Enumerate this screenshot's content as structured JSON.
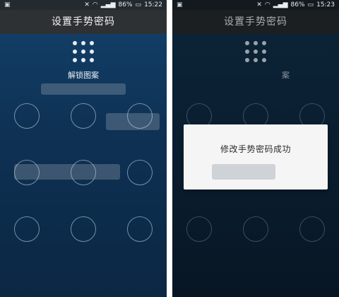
{
  "left_screen": {
    "status": {
      "left_icon": "gallery-icon",
      "battery": "86%",
      "time": "15:22"
    },
    "title": "设置手势密码",
    "hint": "解锁图案"
  },
  "right_screen": {
    "status": {
      "left_icon": "gallery-icon",
      "battery": "86%",
      "time": "15:23"
    },
    "title": "设置手势密码",
    "hint": "案",
    "dialog": {
      "message": "修改手势密码成功"
    }
  },
  "icons": {
    "mute": "🔇",
    "wifi": "📶",
    "signal": "▮",
    "battery": "▬"
  }
}
